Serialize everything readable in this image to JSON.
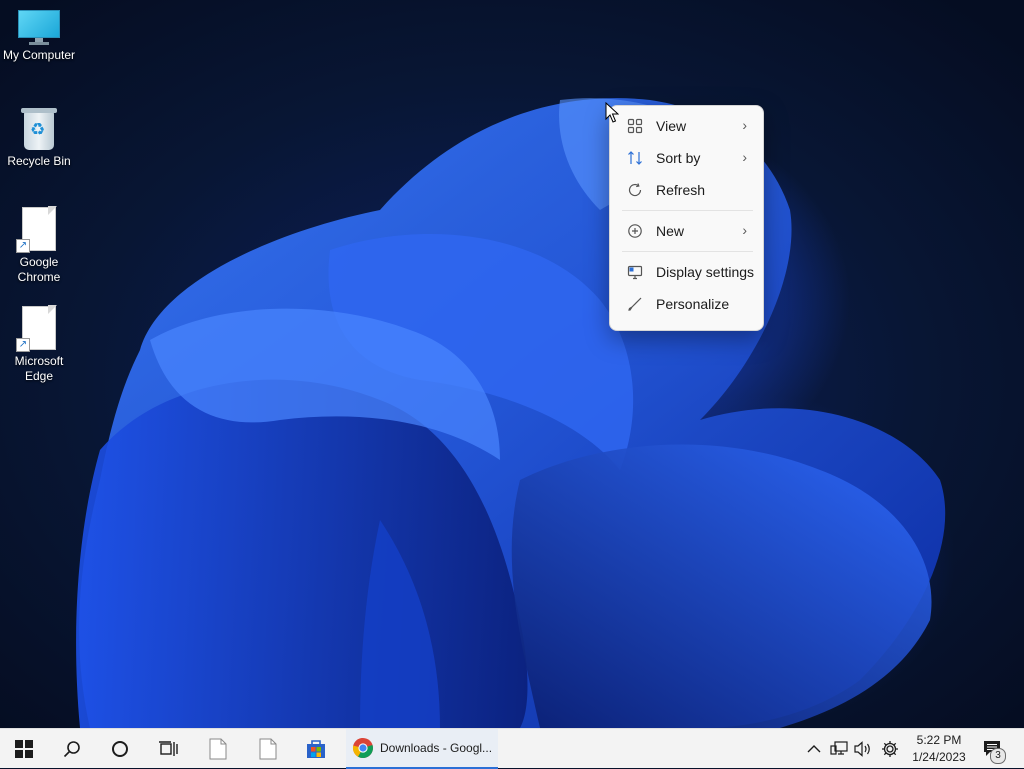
{
  "desktop": {
    "icons": [
      {
        "label": "My Computer",
        "icon": "computer-icon"
      },
      {
        "label": "Recycle Bin",
        "icon": "recycle-bin-icon"
      },
      {
        "label": "Google Chrome",
        "icon": "file-shortcut-icon"
      },
      {
        "label": "Microsoft Edge",
        "icon": "file-shortcut-icon"
      }
    ]
  },
  "context_menu": {
    "items": [
      {
        "label": "View",
        "icon": "grid-view-icon",
        "submenu": true
      },
      {
        "label": "Sort by",
        "icon": "sort-icon",
        "submenu": true
      },
      {
        "label": "Refresh",
        "icon": "refresh-icon",
        "submenu": false
      },
      {
        "label": "New",
        "icon": "plus-circle-icon",
        "submenu": true
      },
      {
        "label": "Display settings",
        "icon": "display-icon",
        "submenu": false
      },
      {
        "label": "Personalize",
        "icon": "brush-icon",
        "submenu": false
      }
    ]
  },
  "taskbar": {
    "pinned": [
      "start-icon",
      "search-icon",
      "cortana-icon",
      "task-view-icon",
      "file-icon",
      "file-icon",
      "store-icon"
    ],
    "active_app": {
      "label": "Downloads - Googl...",
      "icon": "chrome-icon"
    },
    "tray": {
      "icons": [
        "chevron-up-icon",
        "network-icon",
        "volume-icon",
        "settings-gear-icon"
      ],
      "time": "5:22 PM",
      "date": "1/24/2023",
      "notification_count": "3"
    }
  },
  "colors": {
    "accent": "#2b6fd6",
    "taskbar_bg": "#f3f3f3",
    "menu_bg": "#f9f9f9"
  }
}
